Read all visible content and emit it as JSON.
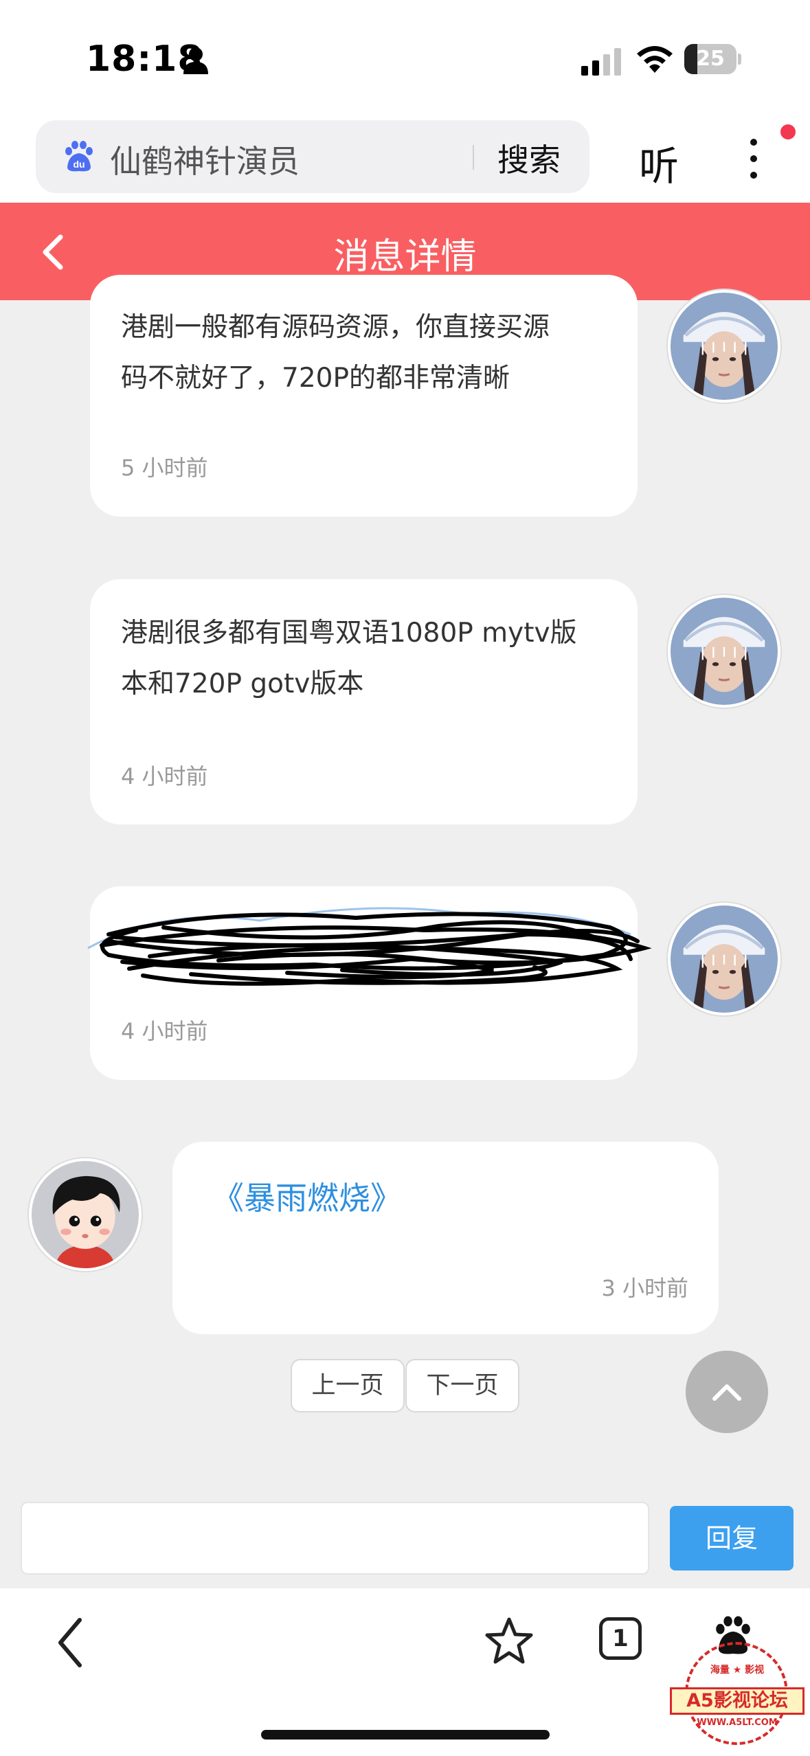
{
  "status_bar": {
    "time": "18:18",
    "battery_level": "25",
    "battery_fraction": 0.25
  },
  "browser": {
    "search_text": "仙鹤神针演员",
    "search_button": "搜索",
    "listen_button": "听"
  },
  "header": {
    "title": "消息详情"
  },
  "messages": [
    {
      "side": "right",
      "text_line1": "港剧一般都有源码资源，你直接买源",
      "text_line2": "码不就好了，720P的都非常清晰",
      "time": "5 小时前"
    },
    {
      "side": "right",
      "text_line1": "港剧很多都有国粤双语1080P mytv版",
      "text_line2": "本和720P gotv版本",
      "time": "4 小时前"
    },
    {
      "side": "right",
      "text_line1": "",
      "text_line2": "",
      "time": "4 小时前",
      "redacted": true
    },
    {
      "side": "left",
      "link_text": "《暴雨燃烧》",
      "time": "3 小时前"
    }
  ],
  "pagination": {
    "prev": "上一页",
    "next": "下一页"
  },
  "reply": {
    "input_value": "",
    "button": "回复"
  },
  "bottom_nav": {
    "tab_count": "1"
  },
  "watermark": {
    "top_text": "海量 ★ 影视",
    "main_text": "A5影视论坛",
    "url_text": "WWW.A5LT.COM"
  },
  "colors": {
    "header_bg": "#f95f62",
    "reply_button": "#3ca0ef",
    "link": "#2d8fe0",
    "page_bg": "#efefef"
  }
}
